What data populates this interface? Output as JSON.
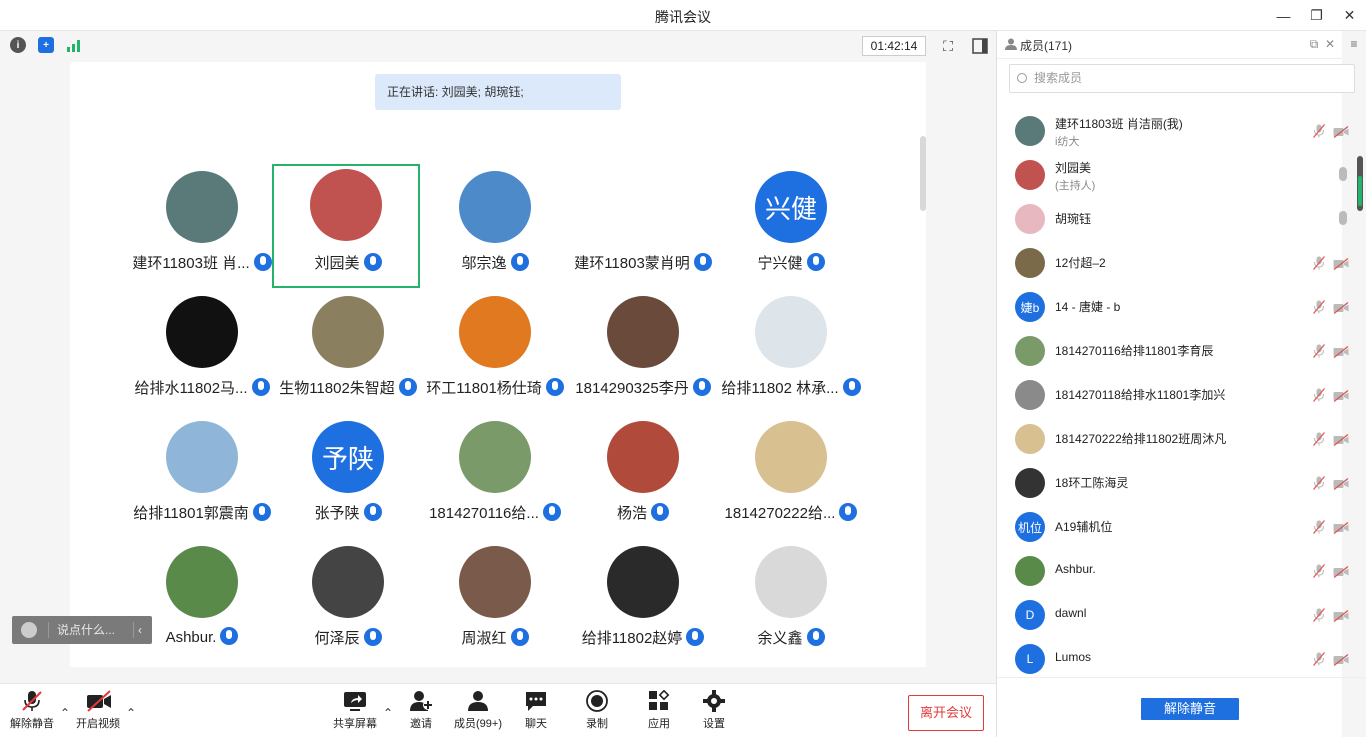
{
  "window": {
    "title": "腾讯会议"
  },
  "stage": {
    "timer": "01:42:14",
    "speaking": "正在讲话: 刘园美; 胡琬钰;",
    "chat_placeholder": "说点什么..."
  },
  "participants": [
    {
      "name": "建环11803班 肖...",
      "avatar_text": "",
      "avatar_color": "#5a7a7a"
    },
    {
      "name": "刘园美",
      "avatar_text": "",
      "avatar_color": "#c0524f",
      "active": true
    },
    {
      "name": "邬宗逸",
      "avatar_text": "",
      "avatar_color": "#4c8ac9"
    },
    {
      "name": "建环11803蒙肖明",
      "avatar_text": "",
      "avatar_color": "#ffffff"
    },
    {
      "name": "宁兴健",
      "avatar_text": "兴健",
      "avatar_color": "#1e6fe0"
    },
    {
      "name": "给排水11802马...",
      "avatar_text": "",
      "avatar_color": "#111111"
    },
    {
      "name": "生物11802朱智超",
      "avatar_text": "",
      "avatar_color": "#8a8060"
    },
    {
      "name": "环工11801杨仕琦",
      "avatar_text": "",
      "avatar_color": "#e0791f"
    },
    {
      "name": "1814290325李丹",
      "avatar_text": "",
      "avatar_color": "#6a4a3a"
    },
    {
      "name": "给排11802 林承...",
      "avatar_text": "",
      "avatar_color": "#dde4ea"
    },
    {
      "name": "给排11801郭震南",
      "avatar_text": "",
      "avatar_color": "#8fb6d9"
    },
    {
      "name": "张予陕",
      "avatar_text": "予陕",
      "avatar_color": "#1e6fe0"
    },
    {
      "name": "1814270116给...",
      "avatar_text": "",
      "avatar_color": "#7a9a6a"
    },
    {
      "name": "杨浩",
      "avatar_text": "",
      "avatar_color": "#b04a3a"
    },
    {
      "name": "1814270222给...",
      "avatar_text": "",
      "avatar_color": "#d8c090"
    },
    {
      "name": "Ashbur.",
      "avatar_text": "",
      "avatar_color": "#5a8a4a"
    },
    {
      "name": "何泽辰",
      "avatar_text": "",
      "avatar_color": "#444444"
    },
    {
      "name": "周淑红",
      "avatar_text": "",
      "avatar_color": "#7a5a4a"
    },
    {
      "name": "给排11802赵婷",
      "avatar_text": "",
      "avatar_color": "#2a2a2a"
    },
    {
      "name": "余义鑫",
      "avatar_text": "",
      "avatar_color": "#d9d9d9"
    }
  ],
  "bottombar": {
    "unmute": "解除静音",
    "start_video": "开启视频",
    "share": "共享屏幕",
    "invite": "邀请",
    "members": "成员(99+)",
    "chat": "聊天",
    "record": "录制",
    "apps": "应用",
    "settings": "设置",
    "leave": "离开会议"
  },
  "panel": {
    "title": "成员(171)",
    "search_placeholder": "搜索成员",
    "unmute_all": "解除静音",
    "members": [
      {
        "name": "建环11803班 肖洁丽(我)",
        "sub": "i纺大",
        "avatar_text": "",
        "avatar_color": "#5a7a7a",
        "mic": "off"
      },
      {
        "name": "刘园美",
        "sub": "(主持人)",
        "avatar_text": "",
        "avatar_color": "#c0524f",
        "mic": "on"
      },
      {
        "name": "胡琬钰",
        "sub": "",
        "avatar_text": "",
        "avatar_color": "#e8b8c0",
        "mic": "on"
      },
      {
        "name": "12付超–2",
        "sub": "",
        "avatar_text": "",
        "avatar_color": "#7a6a4a",
        "mic": "off"
      },
      {
        "name": "14 - 唐婕 - b",
        "sub": "",
        "avatar_text": "婕b",
        "avatar_color": "#1e6fe0",
        "mic": "off"
      },
      {
        "name": "1814270116给排11801李育辰",
        "sub": "",
        "avatar_text": "",
        "avatar_color": "#7a9a6a",
        "mic": "off"
      },
      {
        "name": "1814270118给排水11801李加兴",
        "sub": "",
        "avatar_text": "",
        "avatar_color": "#8a8a8a",
        "mic": "off"
      },
      {
        "name": "1814270222给排11802班周沐凡",
        "sub": "",
        "avatar_text": "",
        "avatar_color": "#d8c090",
        "mic": "off"
      },
      {
        "name": "18环工陈海灵",
        "sub": "",
        "avatar_text": "",
        "avatar_color": "#333333",
        "mic": "off"
      },
      {
        "name": "A19辅机位",
        "sub": "",
        "avatar_text": "机位",
        "avatar_color": "#1e6fe0",
        "mic": "off"
      },
      {
        "name": "Ashbur.",
        "sub": "",
        "avatar_text": "",
        "avatar_color": "#5a8a4a",
        "mic": "off"
      },
      {
        "name": "dawnl",
        "sub": "",
        "avatar_text": "D",
        "avatar_color": "#1e6fe0",
        "mic": "off"
      },
      {
        "name": "Lumos",
        "sub": "",
        "avatar_text": "L",
        "avatar_color": "#1e6fe0",
        "mic": "off"
      }
    ]
  }
}
